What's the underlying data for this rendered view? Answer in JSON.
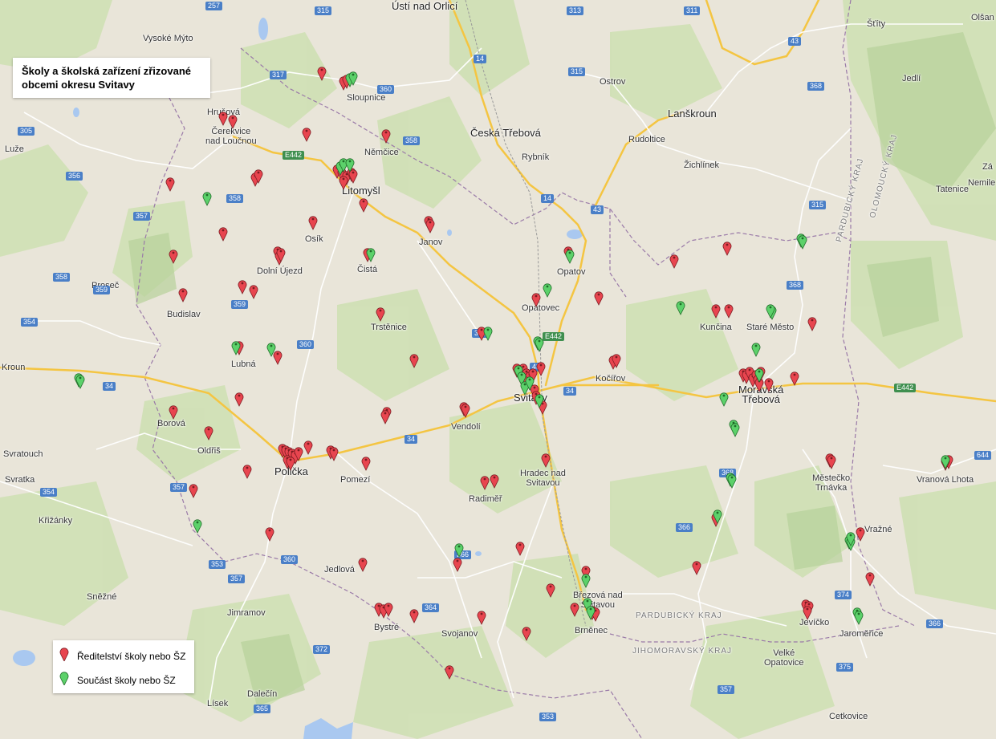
{
  "title": "Školy a školská zařízení zřizované\nobcemi okresu Svitavy",
  "legend": {
    "director": "Ředitelství školy nebo ŠZ",
    "part": "Součást školy nebo ŠZ"
  },
  "colors": {
    "director": "#e8454f",
    "part": "#5cd16a"
  },
  "places": [
    "Ústí nad Orlicí",
    "Vysoké Mýto",
    "Šťíty",
    "Olšan",
    "Ostrov",
    "Jedlí",
    "Sloupnice",
    "Hrušová",
    "Čerekvice nad Loučnou",
    "Luže",
    "Němčice",
    "Česká Třebová",
    "Lanškroun",
    "Rybník",
    "Rudoltice",
    "Žichlínek",
    "Tatenice",
    "Litomyšl",
    "Nemile",
    "Janov",
    "Osík",
    "Dolní Újezd",
    "Čistá",
    "Opatov",
    "Proseč",
    "Budislav",
    "Opatovec",
    "Trstěnice",
    "Kunčina",
    "Staré Město",
    "Lubná",
    "Kočířov",
    "Kroun",
    "Moravská Třebová",
    "Borová",
    "Vendolí",
    "Svitavy",
    "Oldřiš",
    "Svratouch",
    "Polička",
    "Pomezí",
    "Hradec nad Svitavou",
    "Městečko Trnávka",
    "Vranová Lhota",
    "Svratka",
    "Radiměř",
    "Křižánky",
    "Vražné",
    "Jedlová",
    "Březová nad Svitavou",
    "Sněžné",
    "Jimramov",
    "Bystré",
    "Svojanov",
    "Brněnec",
    "Jevíčko",
    "Jaroměřice",
    "Velké Opatovice",
    "Dalečín",
    "Lísek",
    "Cetkovice",
    "Zá"
  ],
  "regions": [
    "PARDUBICKÝ KRAJ",
    "JIHOMORAVSKÝ KRAJ",
    "PARDUBICKÝ KRAJ",
    "OLOMOUCKÝ KRAJ"
  ],
  "roads": [
    "257",
    "315",
    "313",
    "311",
    "317",
    "360",
    "315",
    "368",
    "14",
    "43",
    "305",
    "358",
    "E442",
    "356",
    "358",
    "357",
    "14",
    "43",
    "315",
    "358",
    "359",
    "359",
    "368",
    "354",
    "366",
    "360",
    "E442",
    "43",
    "34",
    "E442",
    "34",
    "34",
    "644",
    "354",
    "357",
    "368",
    "366",
    "360",
    "353",
    "357",
    "364",
    "366",
    "374",
    "366",
    "375",
    "372",
    "357",
    "365",
    "353"
  ],
  "marker_counts": {
    "director": 160,
    "part": 40
  }
}
